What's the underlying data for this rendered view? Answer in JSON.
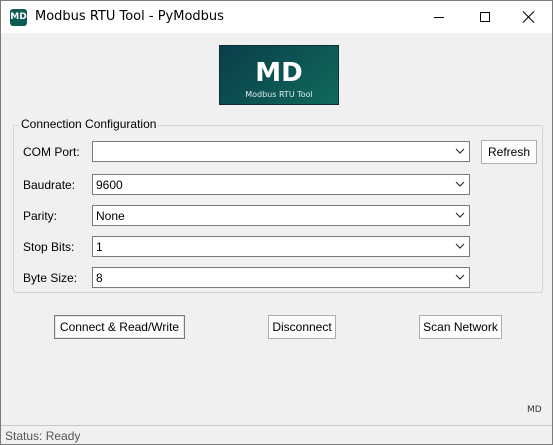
{
  "window": {
    "title": "Modbus RTU Tool - PyModbus",
    "icon_text": "MD"
  },
  "logo": {
    "big_text": "MD",
    "small_text": "Modbus RTU Tool",
    "gradient_colors": [
      "#0b3d4a",
      "#0f6a5a"
    ]
  },
  "connection": {
    "group_title": "Connection Configuration",
    "com_port": {
      "label": "COM Port:",
      "value": ""
    },
    "refresh_label": "Refresh",
    "baudrate": {
      "label": "Baudrate:",
      "value": "9600"
    },
    "parity": {
      "label": "Parity:",
      "value": "None"
    },
    "stop_bits": {
      "label": "Stop Bits:",
      "value": "1"
    },
    "byte_size": {
      "label": "Byte Size:",
      "value": "8"
    }
  },
  "actions": {
    "connect_label": "Connect & Read/Write",
    "disconnect_label": "Disconnect",
    "scan_label": "Scan Network"
  },
  "corner_label": "MD",
  "status": {
    "text": "Status: Ready"
  }
}
